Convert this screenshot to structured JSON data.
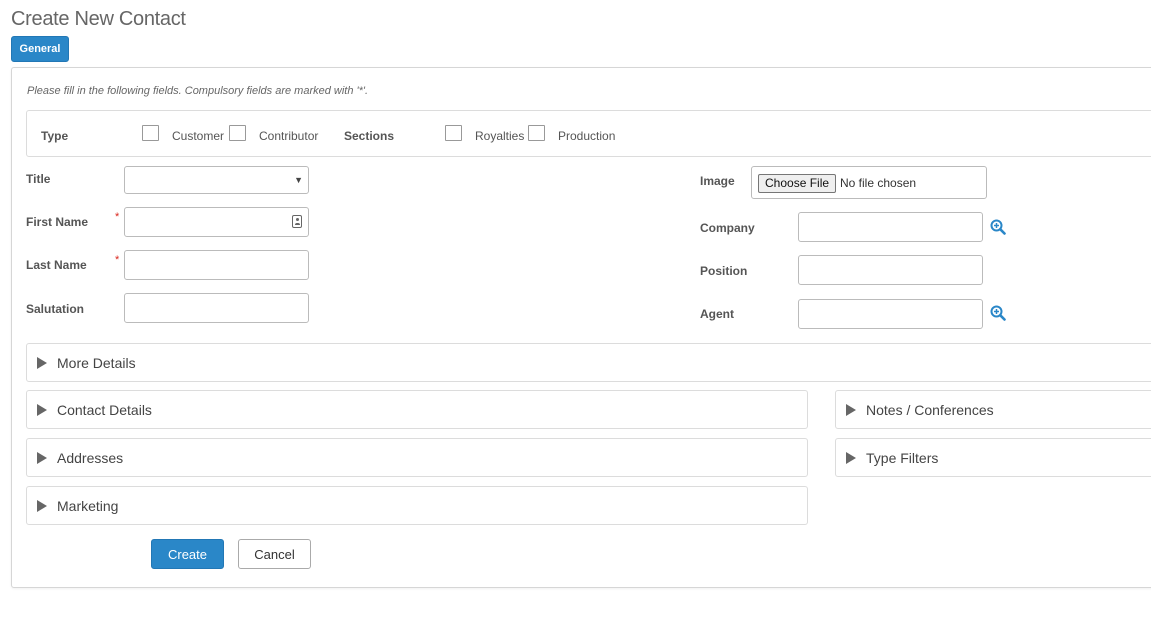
{
  "page": {
    "title": "Create New Contact"
  },
  "tabs": [
    {
      "label": "General",
      "active": true
    }
  ],
  "form": {
    "instructions": "Please fill in the following fields. Compulsory fields are marked with '*'.",
    "type_label": "Type",
    "types": [
      "Customer",
      "Contributor"
    ],
    "sections_label": "Sections",
    "sections": [
      "Royalties",
      "Production"
    ],
    "fields_left": {
      "title": {
        "label": "Title",
        "value": ""
      },
      "first_name": {
        "label": "First Name",
        "required": "*",
        "value": ""
      },
      "last_name": {
        "label": "Last Name",
        "required": "*",
        "value": ""
      },
      "salutation": {
        "label": "Salutation",
        "value": ""
      }
    },
    "fields_right": {
      "image": {
        "label": "Image",
        "button": "Choose File",
        "status": "No file chosen"
      },
      "company": {
        "label": "Company",
        "value": ""
      },
      "position": {
        "label": "Position",
        "value": ""
      },
      "agent": {
        "label": "Agent",
        "value": ""
      }
    },
    "collapsible": {
      "more_details": "More Details",
      "contact_details": "Contact Details",
      "addresses": "Addresses",
      "marketing": "Marketing",
      "notes": "Notes / Conferences",
      "type_filters": "Type Filters"
    },
    "actions": {
      "create": "Create",
      "cancel": "Cancel"
    }
  },
  "colors": {
    "primary": "#2a87c8",
    "required": "#d9251c",
    "icon": "#2a87c8"
  }
}
